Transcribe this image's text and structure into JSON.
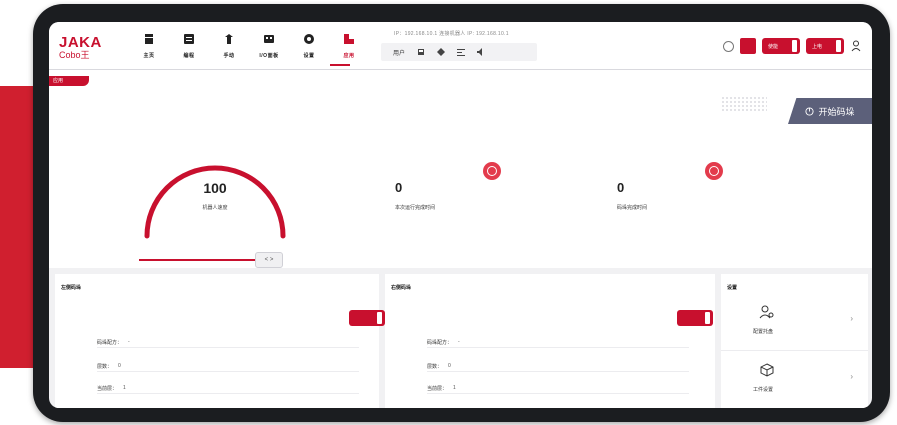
{
  "brand": {
    "name": "JAKA",
    "sub": "Cobo王"
  },
  "nav": {
    "items": [
      {
        "label": "主页",
        "icon": "home-icon"
      },
      {
        "label": "编程",
        "icon": "program-icon"
      },
      {
        "label": "手动",
        "icon": "manual-icon"
      },
      {
        "label": "I/O面板",
        "icon": "io-panel-icon"
      },
      {
        "label": "设置",
        "icon": "settings-icon"
      },
      {
        "label": "应用",
        "icon": "app-icon"
      }
    ],
    "active_index": 5
  },
  "status_line": "IP：192.168.10.1  连接机器人  IP: 192.168.10.1",
  "toolbar": {
    "mode_label": "用户",
    "icon_names": [
      "save-icon",
      "diamond-icon",
      "align-icon",
      "speaker-icon"
    ]
  },
  "right_tools": {
    "btn1_label": "使能",
    "btn2_label": "上电"
  },
  "tag_label": "应用",
  "start_button": {
    "label": "开始码垛",
    "icon": "power-icon"
  },
  "gauge": {
    "value": "100",
    "label": "机器人速度",
    "knob": "< >"
  },
  "stats": [
    {
      "value": "0",
      "label": "本次运行完成时间",
      "icon": "target-icon"
    },
    {
      "value": "0",
      "label": "码垛完成时间",
      "icon": "target-icon"
    }
  ],
  "panels": {
    "left": {
      "title": "左侧码垛",
      "rows": [
        {
          "k": "码垛配方：",
          "v": "-"
        },
        {
          "k": "层数：",
          "v": "0"
        },
        {
          "k": "当前层：",
          "v": "1"
        }
      ]
    },
    "middle": {
      "title": "右侧码垛",
      "rows": [
        {
          "k": "码垛配方：",
          "v": "-"
        },
        {
          "k": "层数：",
          "v": "0"
        },
        {
          "k": "当前层：",
          "v": "1"
        }
      ]
    },
    "right": {
      "title": "设置",
      "cards": [
        {
          "label": "配置托盘",
          "icon": "user-settings-icon"
        },
        {
          "label": "工件设置",
          "icon": "cube-icon"
        }
      ]
    }
  },
  "colors": {
    "accent": "#c8102e",
    "dark": "#1b1d20",
    "start_btn": "#5c607a"
  }
}
